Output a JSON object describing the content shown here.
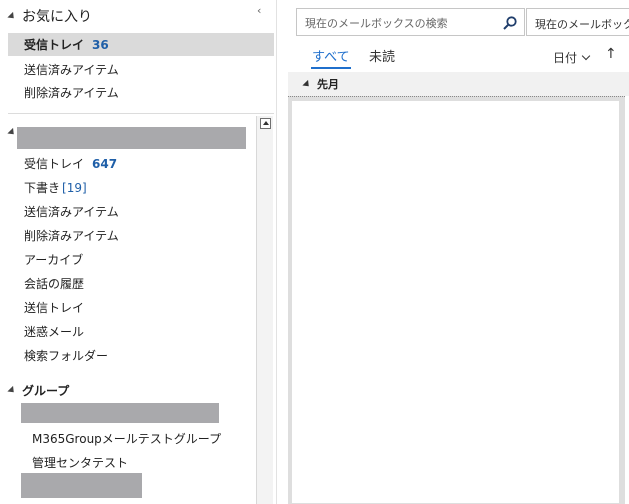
{
  "favorites": {
    "title": "お気に入り",
    "items": [
      {
        "label": "受信トレイ",
        "count": "36"
      },
      {
        "label": "送信済みアイテム"
      },
      {
        "label": "削除済みアイテム"
      }
    ]
  },
  "mailbox": {
    "items": [
      {
        "label": "受信トレイ",
        "count": "647"
      },
      {
        "label": "下書き",
        "count": "[19]"
      },
      {
        "label": "送信済みアイテム"
      },
      {
        "label": "削除済みアイテム"
      },
      {
        "label": "アーカイブ"
      },
      {
        "label": "会話の履歴"
      },
      {
        "label": "送信トレイ"
      },
      {
        "label": "迷惑メール"
      },
      {
        "label": "検索フォルダー"
      }
    ]
  },
  "groups": {
    "title": "グループ",
    "items": [
      {
        "label": "M365Groupメールテストグループ"
      },
      {
        "label": "管理センタテスト"
      }
    ]
  },
  "search": {
    "placeholder": "現在のメールボックスの検索",
    "scope": "現在のメールボックス"
  },
  "tabs": {
    "all": "すべて",
    "unread": "未読"
  },
  "sort": {
    "label": "日付",
    "direction": "↑"
  },
  "list": {
    "group_header": "先月"
  },
  "colors": {
    "accent": "#1f6fcc",
    "count": "#1f5fa8",
    "selected_bg": "#dadada",
    "redaction": "#a9a9ac"
  }
}
